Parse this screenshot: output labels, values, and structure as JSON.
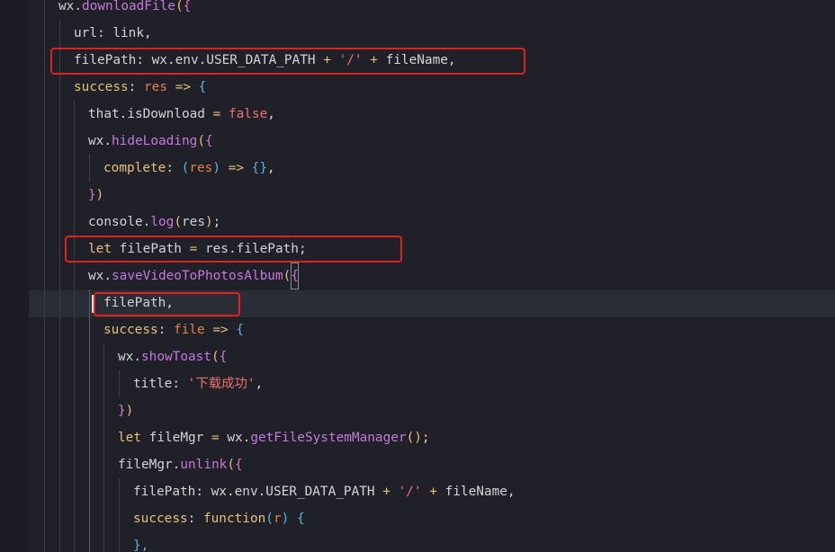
{
  "colors": {
    "background": "#1f2028",
    "identifier": "#d4d4d4",
    "function": "#c678dd",
    "keyword": "#e5c07b",
    "parameter": "#e67e50",
    "string": "#f07070",
    "operator": "#d4d4d4",
    "bracket_gold": "#e5c07b",
    "bracket_pink": "#d678c8",
    "bracket_blue": "#56b6e8",
    "highlight_box": "#e02121"
  },
  "code_lines": [
    {
      "tokens": [
        {
          "text": "wx",
          "color": "#d4d4d4"
        },
        {
          "text": ".",
          "color": "#d4d4d4"
        },
        {
          "text": "downloadFile",
          "color": "#c678dd"
        },
        {
          "text": "(",
          "color": "#e5c07b"
        },
        {
          "text": "{",
          "color": "#d678c8"
        }
      ]
    },
    {
      "tokens": [
        {
          "text": "url",
          "color": "#d4d4d4"
        },
        {
          "text": ": link,",
          "color": "#d4d4d4"
        }
      ]
    },
    {
      "tokens": [
        {
          "text": "filePath",
          "color": "#d4d4d4"
        },
        {
          "text": ": wx.env.USER_DATA_PATH ",
          "color": "#d4d4d4"
        },
        {
          "text": "+",
          "color": "#e5c07b"
        },
        {
          "text": " ",
          "color": "#d4d4d4"
        },
        {
          "text": "'/'",
          "color": "#f07070"
        },
        {
          "text": " ",
          "color": "#d4d4d4"
        },
        {
          "text": "+",
          "color": "#e5c07b"
        },
        {
          "text": " fileName,",
          "color": "#d4d4d4"
        }
      ]
    },
    {
      "tokens": [
        {
          "text": "success",
          "color": "#e5c07b"
        },
        {
          "text": ": ",
          "color": "#d4d4d4"
        },
        {
          "text": "res",
          "color": "#e67e50"
        },
        {
          "text": " ",
          "color": "#d4d4d4"
        },
        {
          "text": "=>",
          "color": "#e5c07b"
        },
        {
          "text": " ",
          "color": "#d4d4d4"
        },
        {
          "text": "{",
          "color": "#56b6e8"
        }
      ]
    },
    {
      "tokens": [
        {
          "text": "that.isDownload ",
          "color": "#d4d4d4"
        },
        {
          "text": "=",
          "color": "#e5c07b"
        },
        {
          "text": " ",
          "color": "#d4d4d4"
        },
        {
          "text": "false",
          "color": "#f07070"
        },
        {
          "text": ",",
          "color": "#d4d4d4"
        }
      ]
    },
    {
      "tokens": [
        {
          "text": "wx",
          "color": "#d4d4d4"
        },
        {
          "text": ".",
          "color": "#d4d4d4"
        },
        {
          "text": "hideLoading",
          "color": "#c678dd"
        },
        {
          "text": "(",
          "color": "#e5c07b"
        },
        {
          "text": "{",
          "color": "#d678c8"
        }
      ]
    },
    {
      "tokens": [
        {
          "text": "complete",
          "color": "#e5c07b"
        },
        {
          "text": ": ",
          "color": "#d4d4d4"
        },
        {
          "text": "(",
          "color": "#56b6e8"
        },
        {
          "text": "res",
          "color": "#e67e50"
        },
        {
          "text": ")",
          "color": "#56b6e8"
        },
        {
          "text": " ",
          "color": "#d4d4d4"
        },
        {
          "text": "=>",
          "color": "#e5c07b"
        },
        {
          "text": " ",
          "color": "#d4d4d4"
        },
        {
          "text": "{}",
          "color": "#56b6e8"
        },
        {
          "text": ",",
          "color": "#d4d4d4"
        }
      ]
    },
    {
      "tokens": [
        {
          "text": "}",
          "color": "#d678c8"
        },
        {
          "text": ")",
          "color": "#e5c07b"
        }
      ]
    },
    {
      "tokens": [
        {
          "text": "console",
          "color": "#d4d4d4"
        },
        {
          "text": ".",
          "color": "#d4d4d4"
        },
        {
          "text": "log",
          "color": "#c678dd"
        },
        {
          "text": "(",
          "color": "#e5c07b"
        },
        {
          "text": "res",
          "color": "#d4d4d4"
        },
        {
          "text": ")",
          "color": "#e5c07b"
        },
        {
          "text": ";",
          "color": "#d4d4d4"
        }
      ]
    },
    {
      "tokens": [
        {
          "text": "let",
          "color": "#e5c07b"
        },
        {
          "text": " filePath ",
          "color": "#d4d4d4"
        },
        {
          "text": "=",
          "color": "#e5c07b"
        },
        {
          "text": " res.filePath;",
          "color": "#d4d4d4"
        }
      ]
    },
    {
      "tokens": [
        {
          "text": "wx",
          "color": "#d4d4d4"
        },
        {
          "text": ".",
          "color": "#d4d4d4"
        },
        {
          "text": "saveVideoToPhotosAlbum",
          "color": "#c678dd"
        },
        {
          "text": "(",
          "color": "#e5c07b"
        },
        {
          "text": "{",
          "color": "#d678c8",
          "matched": true
        }
      ]
    },
    {
      "tokens": [
        {
          "text": "filePath,",
          "color": "#d4d4d4"
        }
      ]
    },
    {
      "tokens": [
        {
          "text": "success",
          "color": "#e5c07b"
        },
        {
          "text": ": ",
          "color": "#d4d4d4"
        },
        {
          "text": "file",
          "color": "#e67e50"
        },
        {
          "text": " ",
          "color": "#d4d4d4"
        },
        {
          "text": "=>",
          "color": "#e5c07b"
        },
        {
          "text": " ",
          "color": "#d4d4d4"
        },
        {
          "text": "{",
          "color": "#56b6e8"
        }
      ]
    },
    {
      "tokens": [
        {
          "text": "wx",
          "color": "#d4d4d4"
        },
        {
          "text": ".",
          "color": "#d4d4d4"
        },
        {
          "text": "showToast",
          "color": "#c678dd"
        },
        {
          "text": "(",
          "color": "#e5c07b"
        },
        {
          "text": "{",
          "color": "#d678c8"
        }
      ]
    },
    {
      "tokens": [
        {
          "text": "title",
          "color": "#d4d4d4"
        },
        {
          "text": ": ",
          "color": "#d4d4d4"
        },
        {
          "text": "'下载成功'",
          "color": "#f07070"
        },
        {
          "text": ",",
          "color": "#d4d4d4"
        }
      ]
    },
    {
      "tokens": [
        {
          "text": "}",
          "color": "#d678c8"
        },
        {
          "text": ")",
          "color": "#e5c07b"
        }
      ]
    },
    {
      "tokens": [
        {
          "text": "let",
          "color": "#e5c07b"
        },
        {
          "text": " fileMgr ",
          "color": "#d4d4d4"
        },
        {
          "text": "=",
          "color": "#e5c07b"
        },
        {
          "text": " wx.",
          "color": "#d4d4d4"
        },
        {
          "text": "getFileSystemManager",
          "color": "#c678dd"
        },
        {
          "text": "()",
          "color": "#e5c07b"
        },
        {
          "text": ";",
          "color": "#d4d4d4"
        }
      ]
    },
    {
      "tokens": [
        {
          "text": "fileMgr",
          "color": "#d4d4d4"
        },
        {
          "text": ".",
          "color": "#d4d4d4"
        },
        {
          "text": "unlink",
          "color": "#c678dd"
        },
        {
          "text": "(",
          "color": "#e5c07b"
        },
        {
          "text": "{",
          "color": "#d678c8"
        }
      ]
    },
    {
      "tokens": [
        {
          "text": "filePath",
          "color": "#d4d4d4"
        },
        {
          "text": ": wx.env.USER_DATA_PATH ",
          "color": "#d4d4d4"
        },
        {
          "text": "+",
          "color": "#e5c07b"
        },
        {
          "text": " ",
          "color": "#d4d4d4"
        },
        {
          "text": "'/'",
          "color": "#f07070"
        },
        {
          "text": " ",
          "color": "#d4d4d4"
        },
        {
          "text": "+",
          "color": "#e5c07b"
        },
        {
          "text": " fileName,",
          "color": "#d4d4d4"
        }
      ]
    },
    {
      "tokens": [
        {
          "text": "success",
          "color": "#e5c07b"
        },
        {
          "text": ": ",
          "color": "#d4d4d4"
        },
        {
          "text": "function",
          "color": "#e5c07b"
        },
        {
          "text": "(",
          "color": "#56b6e8"
        },
        {
          "text": "r",
          "color": "#e67e50"
        },
        {
          "text": ")",
          "color": "#56b6e8"
        },
        {
          "text": " ",
          "color": "#d4d4d4"
        },
        {
          "text": "{",
          "color": "#56b6e8"
        }
      ]
    },
    {
      "tokens": [
        {
          "text": "},",
          "color": "#56b6e8"
        }
      ]
    }
  ]
}
